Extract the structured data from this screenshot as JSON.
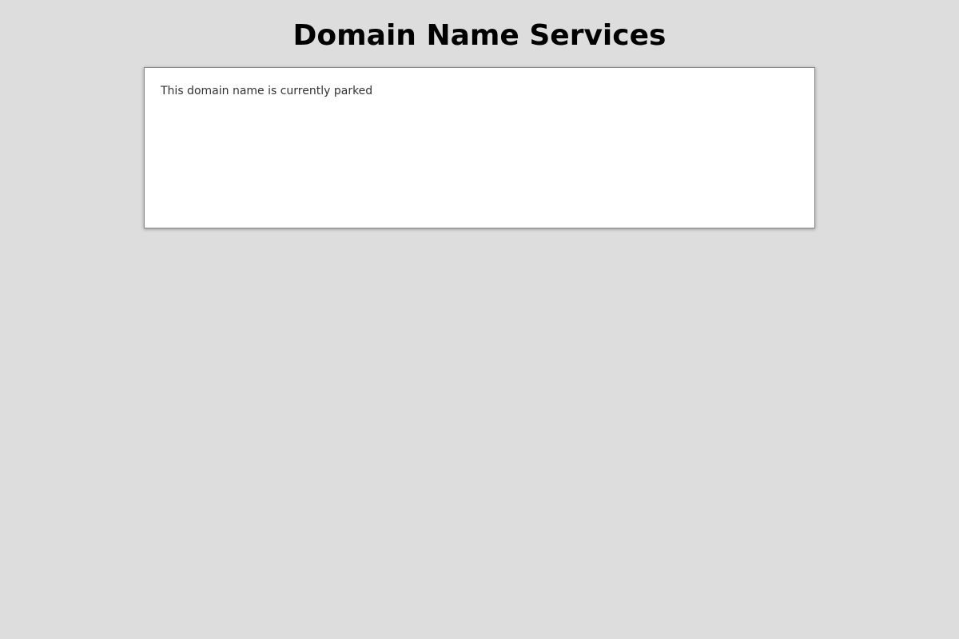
{
  "header": {
    "title": "Domain Name Services"
  },
  "content": {
    "message": "This domain name is currently parked"
  },
  "colors": {
    "background": "#dddddd",
    "box_background": "#ffffff",
    "box_border": "#8a8a8a",
    "title_text": "#000000",
    "body_text": "#333333"
  }
}
